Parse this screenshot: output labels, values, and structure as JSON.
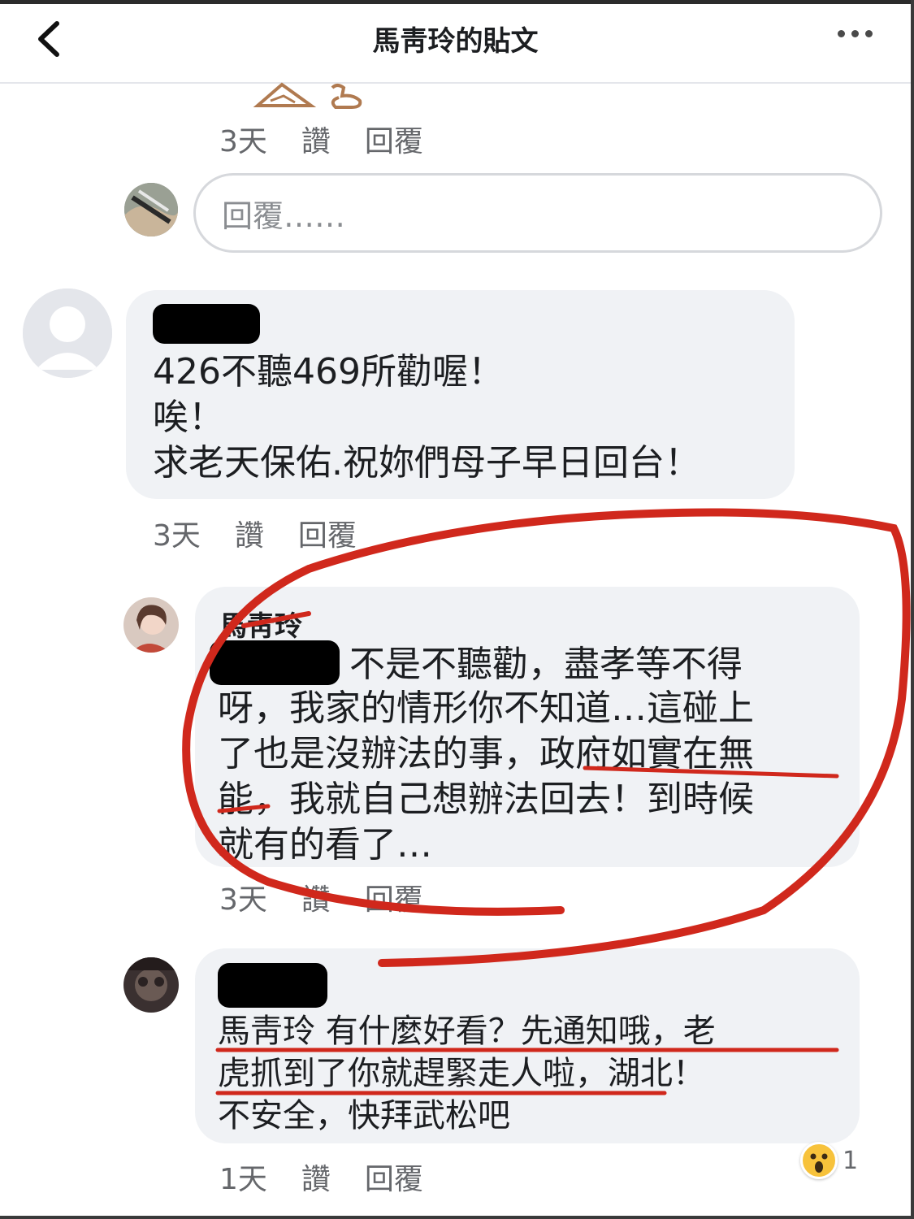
{
  "header": {
    "title": "馬靑玲的貼文"
  },
  "first_meta": {
    "time": "3天",
    "like": "讚",
    "reply": "回覆"
  },
  "reply_box": {
    "placeholder": "回覆……"
  },
  "comment1": {
    "lines": [
      "426不聽469所勸喔！",
      "唉！",
      "求老天保佑.祝妳們母子早日回台！"
    ],
    "meta": {
      "time": "3天",
      "like": "讚",
      "reply": "回覆"
    }
  },
  "comment2": {
    "author": "馬靑玲",
    "line1": "不是不聽勸，盡孝等不得",
    "lines": [
      "呀，我家的情形你不知道…這碰上",
      "了也是沒辦法的事，政府如實在無",
      "能，我就自己想辦法回去！到時候",
      "就有的看了…"
    ],
    "meta": {
      "time": "3天",
      "like": "讚",
      "reply": "回覆"
    }
  },
  "comment3": {
    "lines": [
      "馬靑玲 有什麼好看？先通知哦，老",
      "虎抓到了你就趕緊走人啦，湖北！",
      "不安全，快拜武松吧"
    ],
    "meta": {
      "time": "1天",
      "like": "讚",
      "reply": "回覆"
    },
    "reaction": {
      "icon": "wow-emoji-icon",
      "count": "1"
    }
  },
  "colors": {
    "annotation_red": "#d0281c",
    "bubble": "#f0f2f5",
    "meta_text": "#65676b"
  }
}
